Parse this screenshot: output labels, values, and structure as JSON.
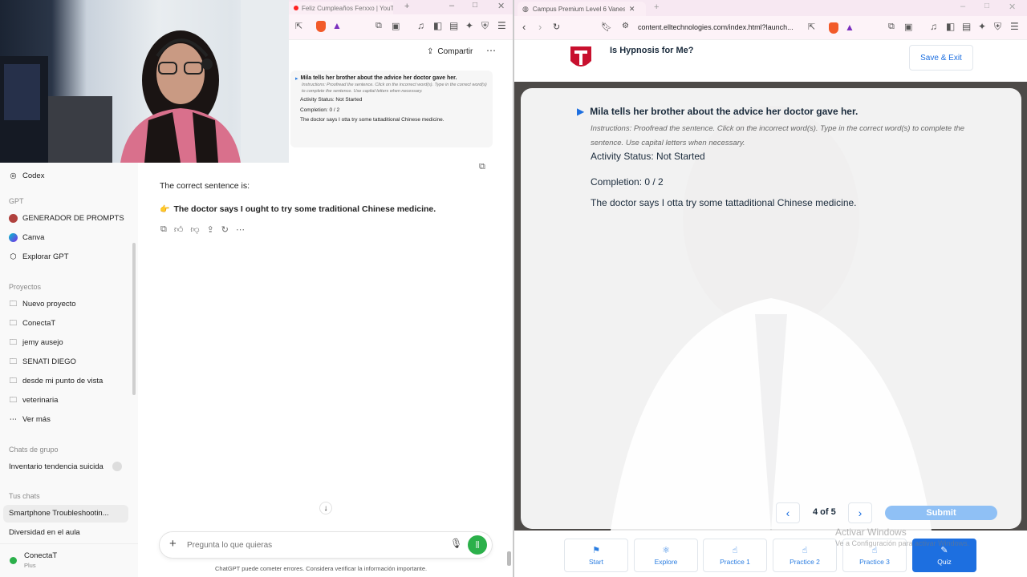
{
  "left": {
    "tab_title": "Feliz Cumpleaños Ferxxo | YouTub",
    "share_label": "Compartir",
    "thumbnail": {
      "title": "Mila tells her brother about the advice her doctor gave her.",
      "instructions": "Instructions: Proofread the sentence. Click on the incorrect word(s). Type in the correct word(s) to complete the sentence. Use capital letters when necessary.",
      "status": "Activity Status: Not Started",
      "completion": "Completion: 0 / 2",
      "sentence": "The doctor says I otta try some tattaditional Chinese medicine."
    },
    "sidebar": {
      "codex": "Codex",
      "gpt_header": "GPT",
      "gpt_items": [
        "GENERADOR DE PROMPTS",
        "Canva",
        "Explorar GPT"
      ],
      "projects_header": "Proyectos",
      "projects": [
        "Nuevo proyecto",
        "ConectaT",
        "jemy ausejo",
        "SENATI DIEGO",
        "desde mi punto de vista",
        "veterinaria",
        "Ver más"
      ],
      "group_header": "Chats de grupo",
      "group_chat": "Inventario tendencia suicida",
      "your_chats_header": "Tus chats",
      "chats": [
        "Smartphone Troubleshootin...",
        "Diversidad en el aula"
      ],
      "user_name": "ConectaT",
      "user_plan": "Plus"
    },
    "chat": {
      "intro": "The correct sentence is:",
      "emoji": "👉",
      "answer": "The doctor says I ought to try some traditional Chinese medicine.",
      "placeholder": "Pregunta lo que quieras",
      "disclaimer": "ChatGPT puede cometer errores. Considera verificar la información importante."
    }
  },
  "right": {
    "tab_title": "Campus Premium Level 6 Vanes",
    "url": "content.elltechnologies.com/index.html?launch...",
    "app_title": "Is Hypnosis for Me?",
    "save_exit": "Save & Exit",
    "activity": {
      "title": "Mila tells her brother about the advice her doctor gave her.",
      "instructions": "Instructions: Proofread the sentence. Click on the incorrect word(s). Type in the correct word(s) to complete the sentence. Use capital letters when necessary.",
      "status": "Activity Status: Not Started",
      "completion": "Completion: 0 / 2",
      "sentence": "The doctor says I otta try some tattaditional Chinese medicine."
    },
    "pager": "4 of 5",
    "submit": "Submit",
    "watermark_title": "Activar Windows",
    "watermark_sub": "Ve a Configuración para activar Windows.",
    "nav_tabs": [
      "Start",
      "Explore",
      "Practice 1",
      "Practice 2",
      "Practice 3",
      "Quiz"
    ],
    "active_tab": "Quiz"
  },
  "colors": {
    "accent_blue": "#1d6fe0",
    "logo_red": "#c8102e",
    "submit_blue": "#8fc0f5",
    "chat_send_green": "#2bb04a"
  }
}
